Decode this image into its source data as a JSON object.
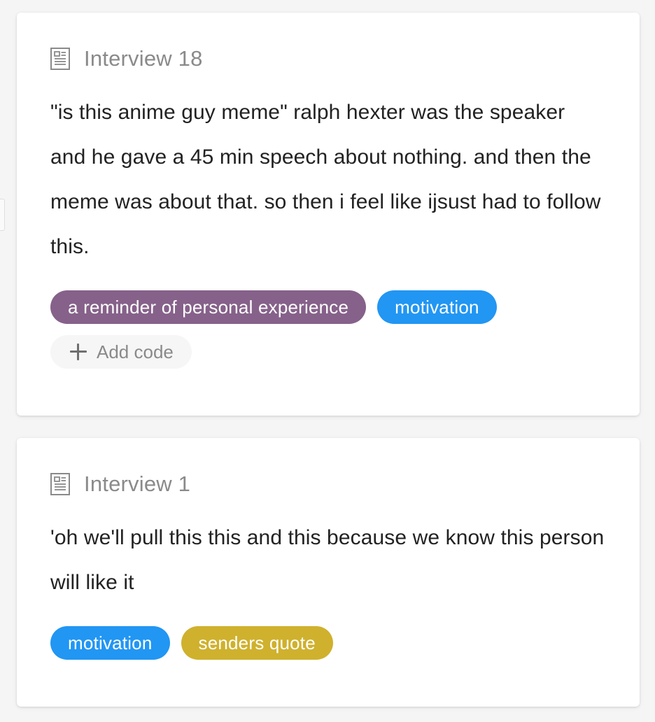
{
  "colors": {
    "personal_experience": "#86618a",
    "motivation": "#2196f3",
    "senders_quote": "#cfb12d"
  },
  "cards": [
    {
      "icon": "document-icon",
      "title": "Interview 18",
      "quote": "\"is this anime guy meme\" ralph hexter was the speaker and he gave a 45 min speech about nothing. and then the meme was about that. so then i feel like ijsust had to follow this.",
      "codes": [
        {
          "label": "a reminder of personal experience",
          "color": "#86618a"
        },
        {
          "label": "motivation",
          "color": "#2196f3"
        }
      ],
      "add_code_label": "Add code"
    },
    {
      "icon": "document-icon",
      "title": "Interview 1",
      "quote": "'oh we'll pull this this and this because we know this person will like it",
      "codes": [
        {
          "label": "motivation",
          "color": "#2196f3"
        },
        {
          "label": "senders quote",
          "color": "#cfb12d"
        }
      ]
    }
  ]
}
